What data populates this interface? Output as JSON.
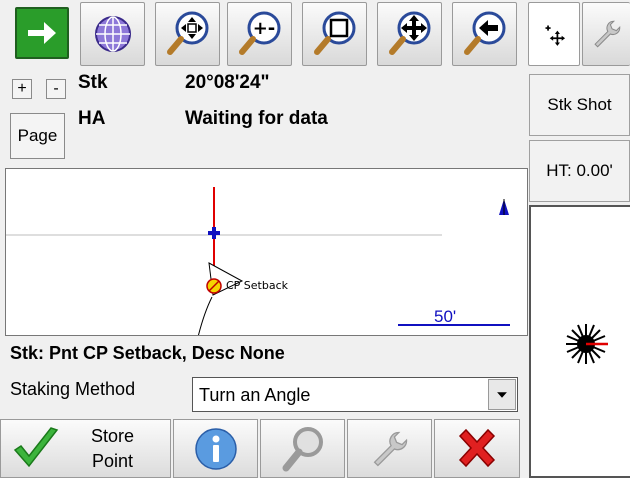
{
  "toolbar": {
    "icons": [
      "arrow-right-icon",
      "globe-icon",
      "zoom-extents-icon",
      "zoom-in-out-icon",
      "zoom-window-icon",
      "pan-icon",
      "zoom-previous-icon",
      "crosshair-icon",
      "wrench-icon"
    ]
  },
  "header": {
    "plus_label": "+",
    "minus_label": "-",
    "page_label": "Page",
    "row1_key": "Stk",
    "row1_value": "20°08'24\"",
    "row2_key": "HA",
    "row2_value": "Waiting for data"
  },
  "side": {
    "stk_shot_label": "Stk Shot",
    "ht_label": "HT: 0.00'"
  },
  "map": {
    "point_label": "CP Setback",
    "scale_label": "50'"
  },
  "status_line": "Stk: Pnt CP Setback, Desc None",
  "staking": {
    "method_label": "Staking Method",
    "method_value": "Turn an Angle"
  },
  "bottom": {
    "store_label_1": "Store",
    "store_label_2": "Point"
  },
  "colors": {
    "accent_green": "#1a9e2e",
    "line_red": "#e00000",
    "marker_blue": "#1010c0"
  }
}
